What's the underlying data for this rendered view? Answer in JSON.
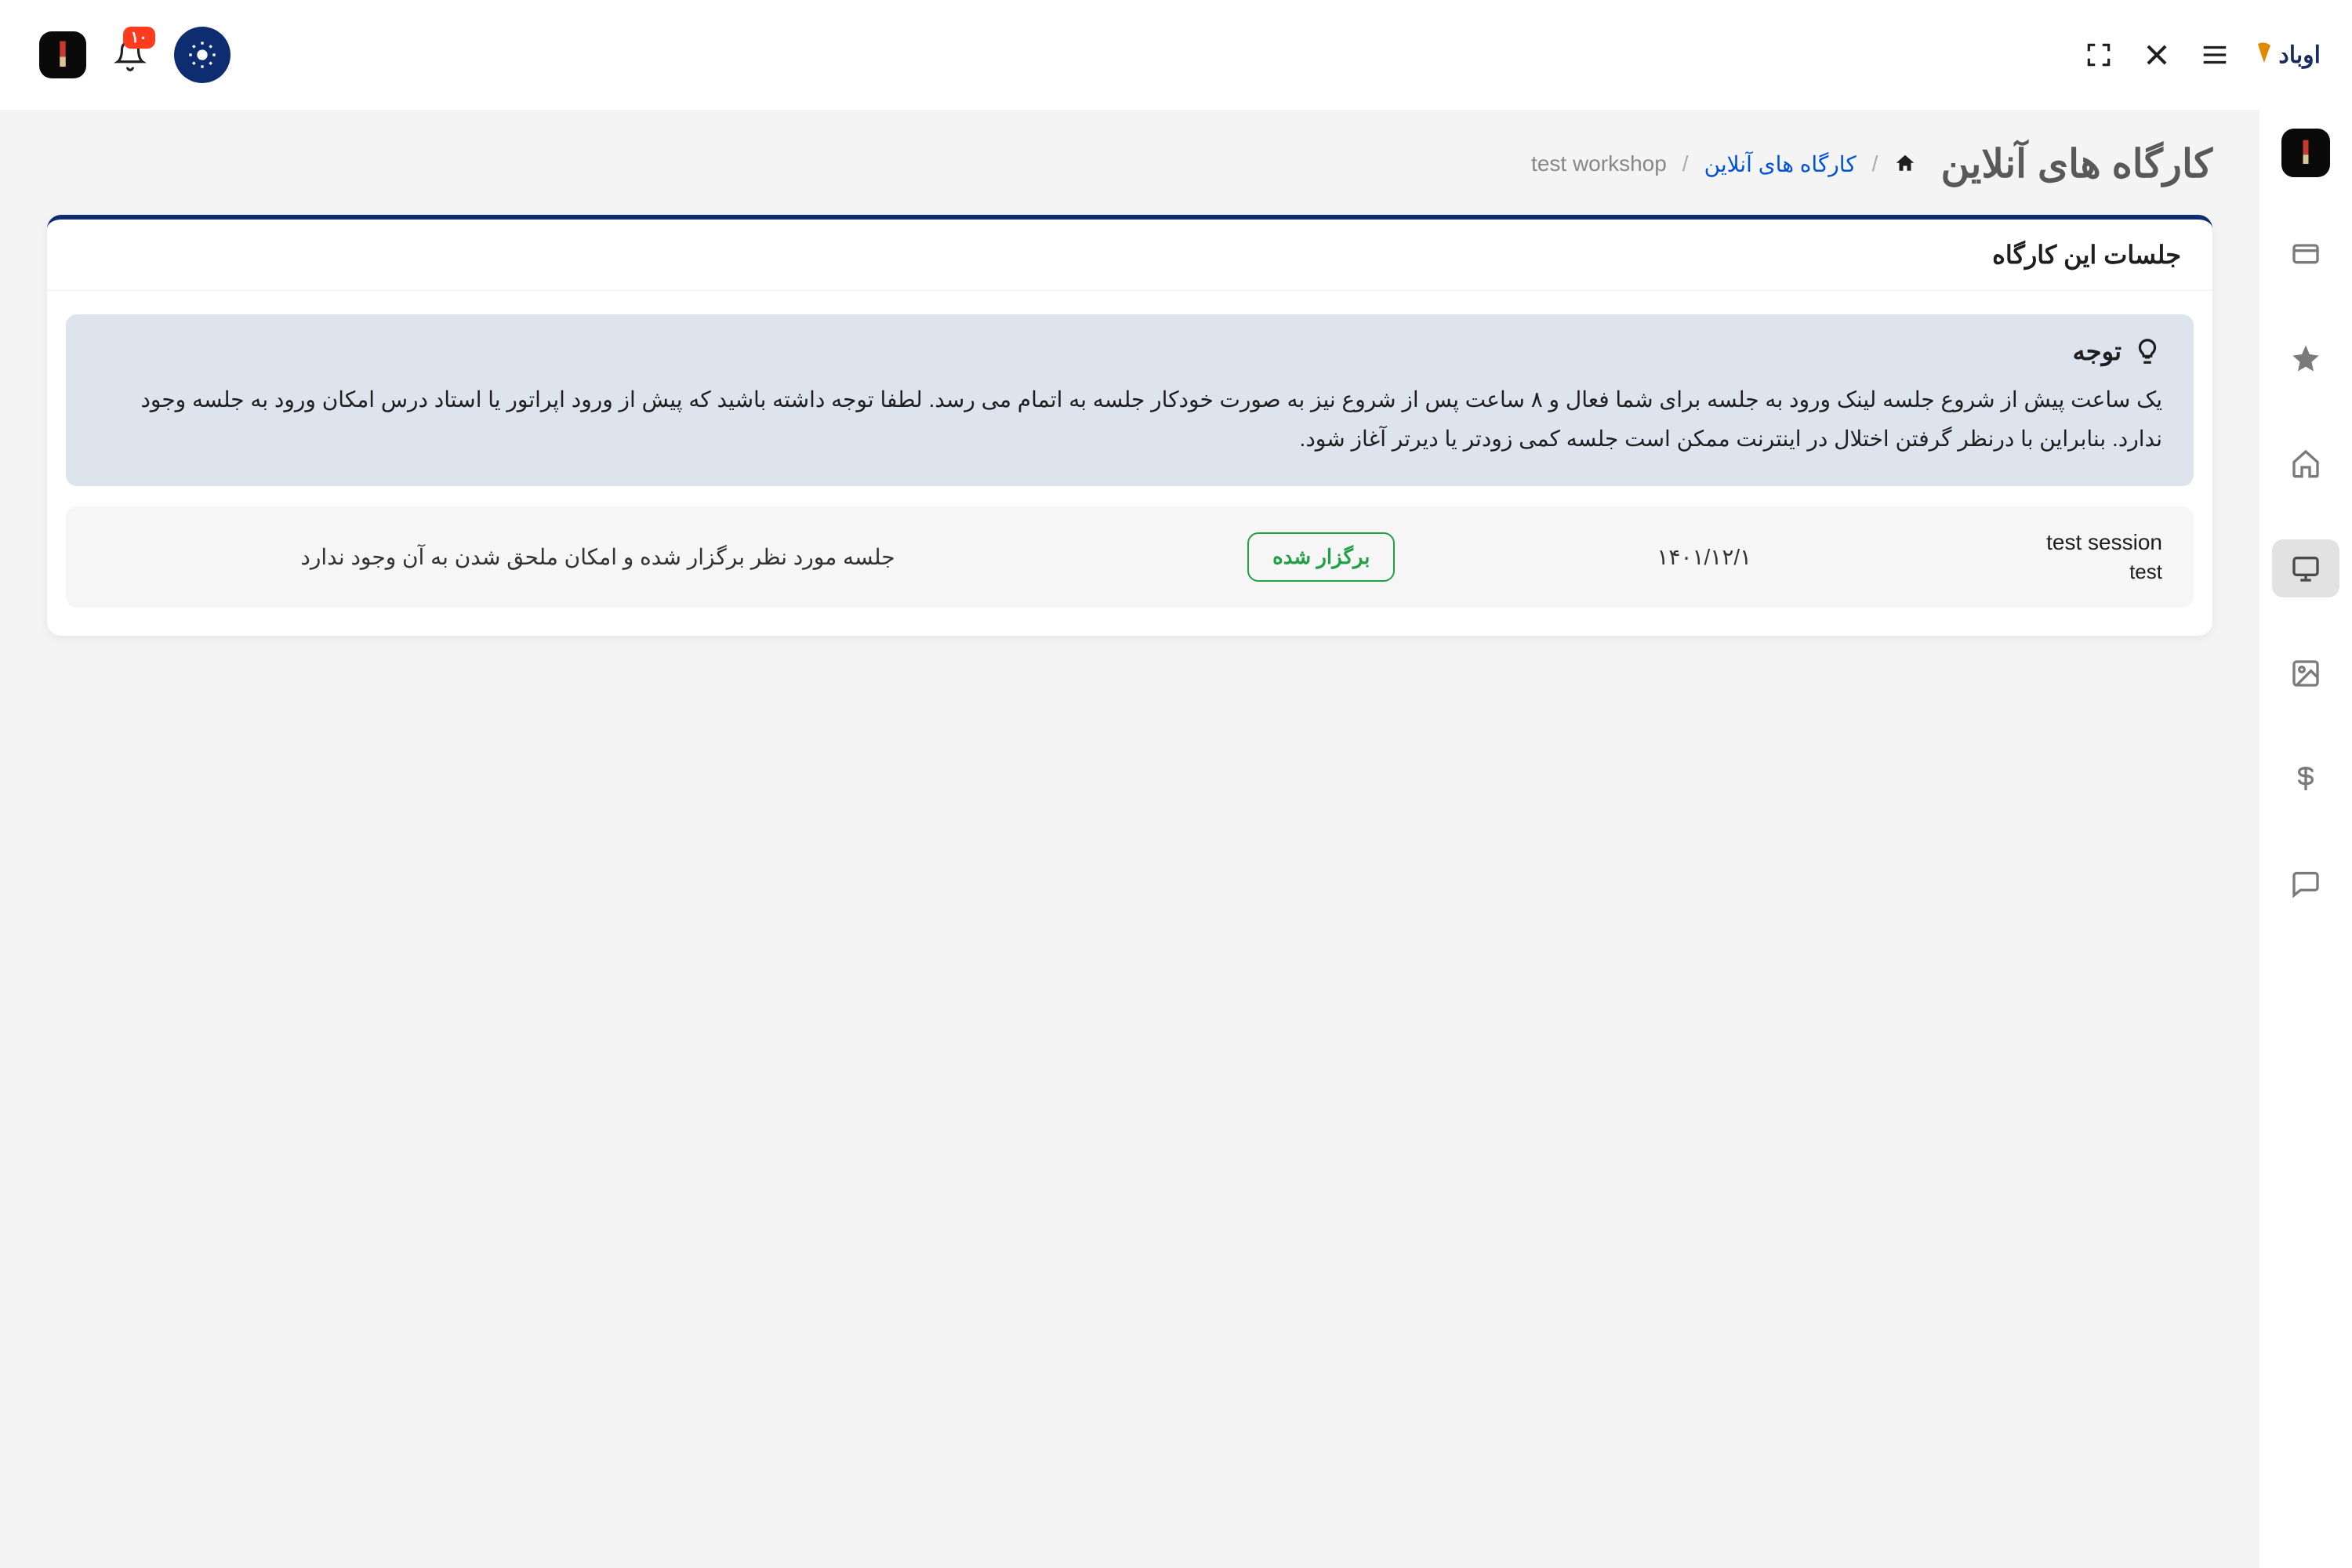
{
  "header": {
    "brand": "اوباد",
    "notif_count": "۱۰"
  },
  "page": {
    "title": "کارگاه های آنلاین"
  },
  "breadcrumb": {
    "workshops": "کارگاه های آنلاین",
    "current": "test workshop"
  },
  "card": {
    "title": "جلسات این کارگاه"
  },
  "alert": {
    "title": "توجه",
    "text": "یک ساعت پیش از شروع جلسه لینک ورود به جلسه برای شما فعال و ۸ ساعت پس از شروع نیز به صورت خودکار جلسه به اتمام می رسد. لطفا توجه داشته باشید که پیش از ورود اپراتور یا استاد درس امکان ورود به جلسه وجود ندارد. بنابراین با درنظر گرفتن اختلال در اینترنت ممکن است جلسه کمی زودتر یا دیرتر آغاز شود."
  },
  "sessions": [
    {
      "name": "test session",
      "type": "test",
      "date": "۱۴۰۱/۱۲/۱",
      "status": "برگزار شده",
      "note": "جلسه مورد نظر برگزار شده و امکان ملحق شدن به آن وجود ندارد"
    }
  ]
}
